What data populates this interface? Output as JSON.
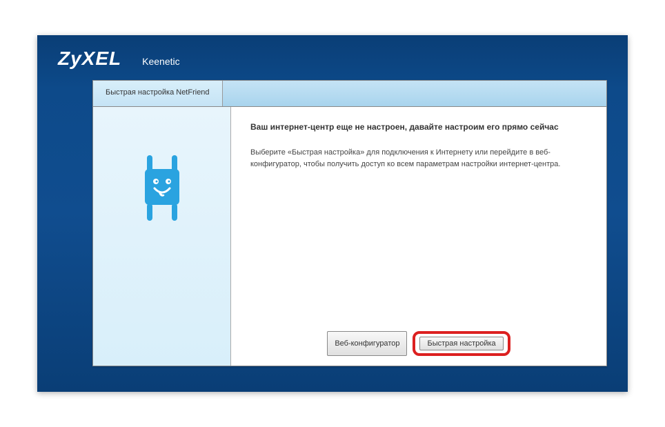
{
  "header": {
    "brand": "ZyXEL",
    "product": "Keenetic"
  },
  "tab": {
    "label": "Быстрая настройка NetFriend"
  },
  "main": {
    "title": "Ваш интернет-центр еще не настроен, давайте настроим его прямо сейчас",
    "body": "Выберите «Быстрая настройка» для подключения к Интернету или перейдите в веб-конфигуратор, чтобы получить доступ ко всем параметрам настройки интернет-центра."
  },
  "buttons": {
    "web_configurator": "Веб-конфигуратор",
    "quick_setup": "Быстрая настройка"
  }
}
